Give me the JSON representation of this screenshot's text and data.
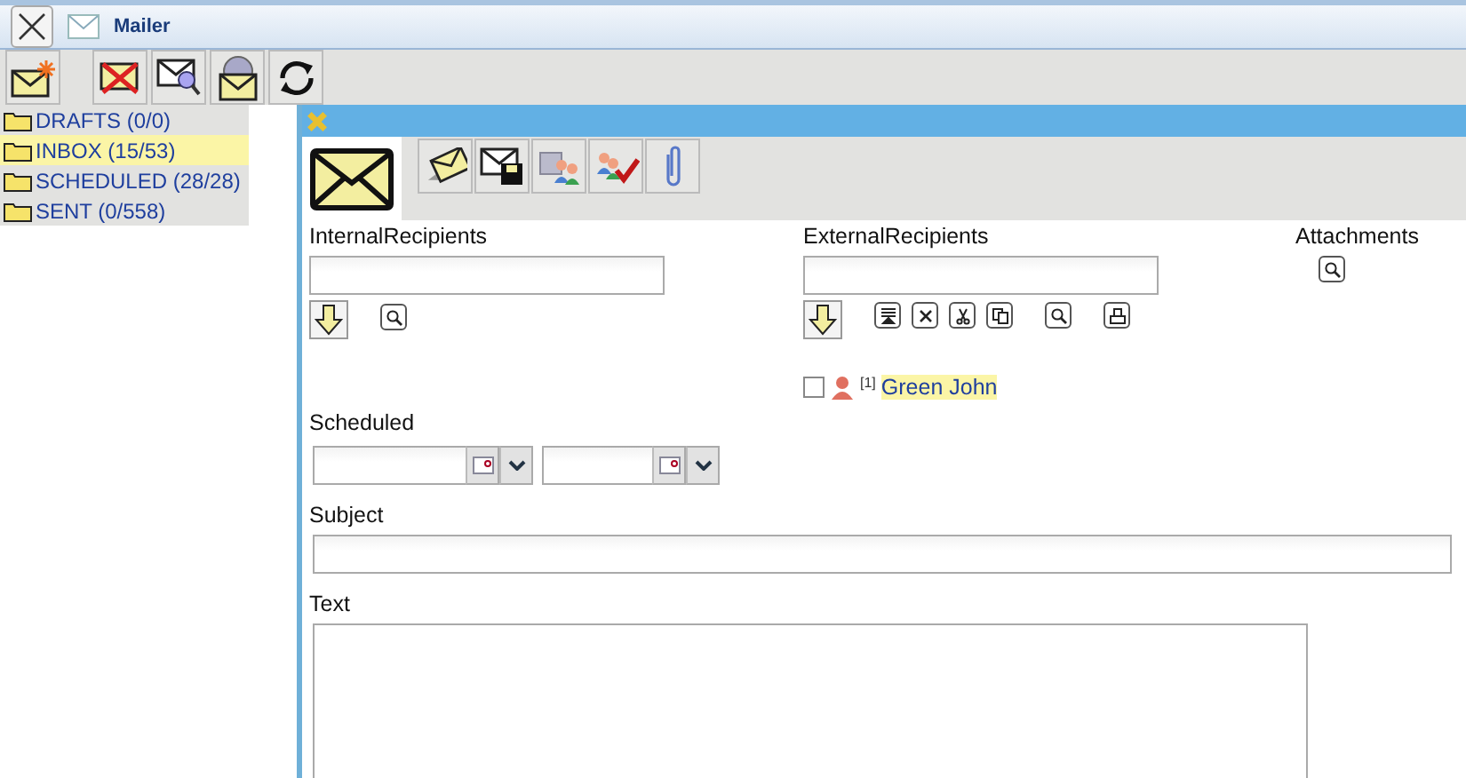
{
  "window": {
    "title": "Mailer"
  },
  "folders": [
    {
      "label": "DRAFTS (0/0)",
      "selected": false
    },
    {
      "label": "INBOX (15/53)",
      "selected": true
    },
    {
      "label": "SCHEDULED (28/28)",
      "selected": false
    },
    {
      "label": "SENT (0/558)",
      "selected": false
    }
  ],
  "compose": {
    "internal_recipients": {
      "label": "InternalRecipients"
    },
    "external_recipients": {
      "label": "ExternalRecipients",
      "items": [
        {
          "index": "[1]",
          "name": "Green John",
          "checked": false
        }
      ]
    },
    "attachments": {
      "label": "Attachments"
    },
    "scheduled": {
      "label": "Scheduled"
    },
    "subject": {
      "label": "Subject"
    },
    "text": {
      "label": "Text"
    }
  }
}
